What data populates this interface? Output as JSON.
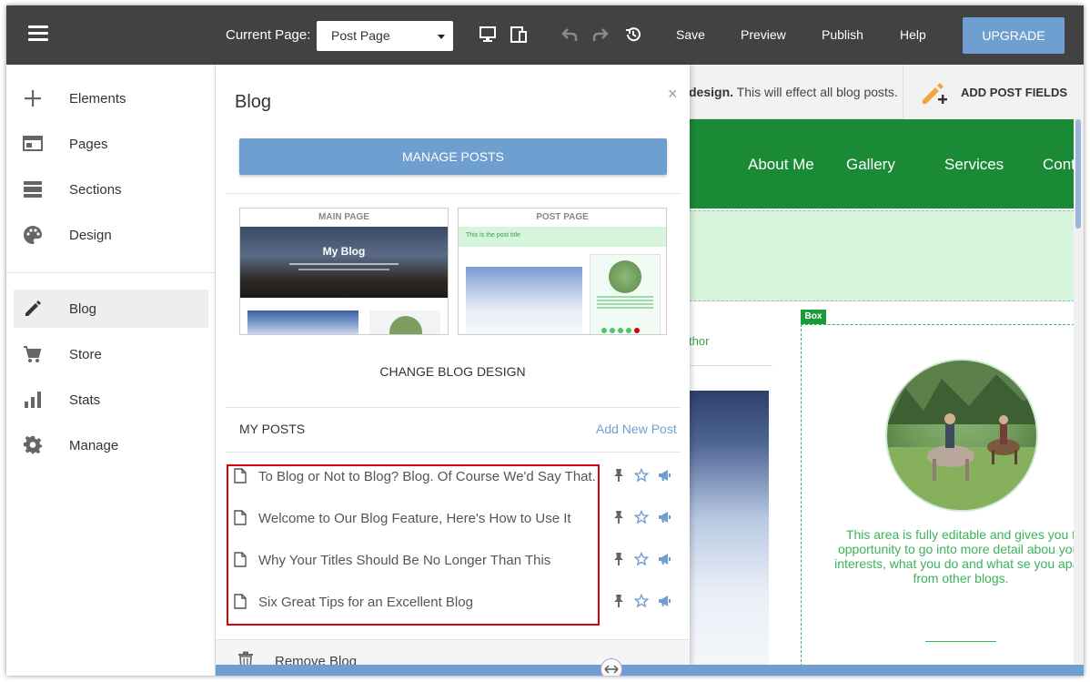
{
  "topbar": {
    "current_page_label": "Current Page:",
    "page_select_value": "Post Page",
    "undo_icon": "undo-icon",
    "redo_icon": "redo-icon",
    "history_icon": "history-icon",
    "save": "Save",
    "preview": "Preview",
    "publish": "Publish",
    "help": "Help",
    "upgrade": "UPGRADE"
  },
  "sidebar": {
    "items": [
      {
        "label": "Elements",
        "icon": "plus-icon"
      },
      {
        "label": "Pages",
        "icon": "pages-icon"
      },
      {
        "label": "Sections",
        "icon": "sections-icon"
      },
      {
        "label": "Design",
        "icon": "palette-icon"
      },
      {
        "label": "Blog",
        "icon": "pencil-icon",
        "active": true
      },
      {
        "label": "Store",
        "icon": "cart-icon"
      },
      {
        "label": "Stats",
        "icon": "stats-icon"
      },
      {
        "label": "Manage",
        "icon": "gear-icon"
      }
    ]
  },
  "blog_panel": {
    "title": "Blog",
    "close": "×",
    "manage_posts": "MANAGE POSTS",
    "thumbs": {
      "main_caption": "MAIN PAGE",
      "main_title": "My Blog",
      "post_caption": "POST PAGE",
      "post_band_text": "This is the post title"
    },
    "change_design": "CHANGE BLOG DESIGN",
    "my_posts_label": "MY POSTS",
    "add_new_post": "Add New Post",
    "posts": [
      {
        "title": "To Blog or Not to Blog? Blog. Of Course We'd Say That."
      },
      {
        "title": "Welcome to Our Blog Feature, Here's How to Use It"
      },
      {
        "title": "Why Your Titles Should Be No Longer Than This"
      },
      {
        "title": "Six Great Tips for an Excellent Blog"
      }
    ],
    "remove_blog": "Remove Blog"
  },
  "preview": {
    "hint_bold": "design.",
    "hint_rest": " This will effect all blog posts.",
    "add_post_fields": "ADD POST FIELDS",
    "nav": [
      "About Me",
      "Gallery",
      "Services",
      "Cont"
    ],
    "author_fragment": "thor",
    "box_label": "Box",
    "box_text": "This area is fully editable and gives you t opportunity to go into more detail abou your interests, what you do and what se you apart from other blogs."
  },
  "colors": {
    "topbar": "#424242",
    "accent_blue": "#6f9fd0",
    "site_green": "#1b8a37",
    "highlight_red": "#d9000d"
  }
}
